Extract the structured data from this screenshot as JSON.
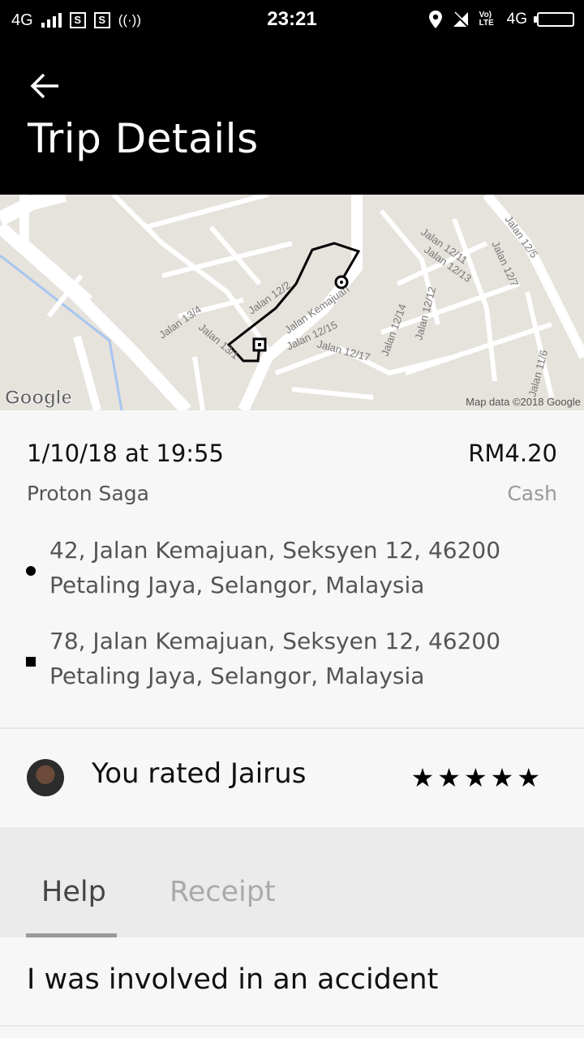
{
  "status_bar": {
    "network_left": "4G",
    "time": "23:21",
    "network_right": "4G",
    "volte": "Vo) LTE",
    "icons": [
      "signal-icon",
      "s-app-icon",
      "s-app-icon",
      "hotspot-icon",
      "location-icon",
      "muted-icon",
      "volte-icon",
      "battery-icon"
    ]
  },
  "header": {
    "title": "Trip Details",
    "back_icon": "back-arrow-icon"
  },
  "map": {
    "attribution": "Map data ©2018 Google",
    "logo": "Google",
    "street_labels": [
      "Jalan 13/4",
      "Jalan 13/1",
      "Jalan 12/2",
      "Jalan Kemajuan",
      "Jalan 12/15",
      "Jalan 12/17",
      "Jalan 12/14",
      "Jalan 12/12",
      "Jalan 12/13",
      "Jalan 12/11",
      "Jalan 12/7",
      "Jalan 12/5",
      "Jalan 11/6"
    ]
  },
  "trip": {
    "date": "1/10/18 at 19:55",
    "fare": "RM4.20",
    "vehicle": "Proton Saga",
    "payment": "Cash",
    "pickup_line1": "42, Jalan Kemajuan, Seksyen 12, 46200",
    "pickup_line2": "Petaling Jaya, Selangor, Malaysia",
    "dropoff_line1": "78, Jalan Kemajuan, Seksyen 12, 46200",
    "dropoff_line2": "Petaling Jaya, Selangor, Malaysia"
  },
  "rating": {
    "text": "You rated Jairus",
    "stars": "★★★★★",
    "star_count": 5
  },
  "tabs": [
    {
      "label": "Help",
      "active": true
    },
    {
      "label": "Receipt",
      "active": false
    }
  ],
  "help_items": [
    {
      "label": "I was involved in an accident"
    }
  ],
  "colors": {
    "header_bg": "#000000",
    "page_bg": "#f7f7f7",
    "tab_bar_bg": "#ebebeb"
  }
}
